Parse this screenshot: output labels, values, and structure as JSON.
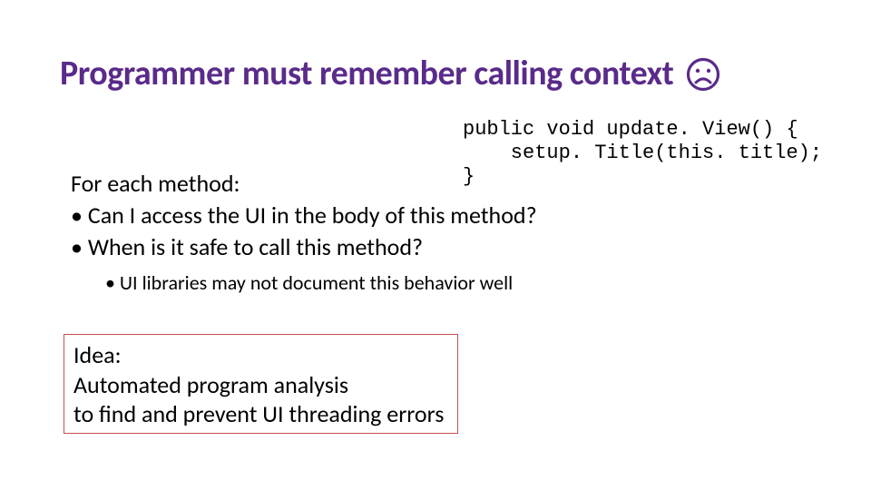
{
  "title": "Programmer must remember calling context",
  "code": {
    "l1": "public void update. View() {",
    "l2": "    setup. Title(this. title);",
    "l3": "}"
  },
  "body": {
    "foreach": "For each method:",
    "b1": "• Can I access the UI in the body of this method?",
    "b2": "• When is it safe to call this method?",
    "sub": "• UI libraries may not document this behavior well"
  },
  "idea": {
    "l1": "Idea:",
    "l2": "Automated program analysis",
    "l3": "to find and prevent UI threading errors"
  },
  "colors": {
    "accent": "#5a2b8a",
    "box_border": "#c0504d"
  }
}
